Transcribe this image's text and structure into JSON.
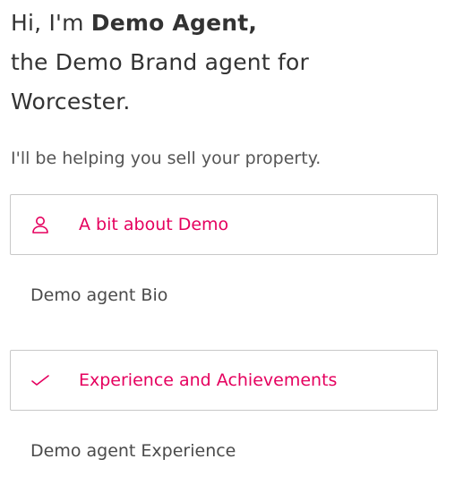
{
  "intro": {
    "greeting": "Hi, I'm ",
    "agent_name": "Demo Agent,",
    "line2": "the Demo Brand agent for",
    "line3": "Worcester."
  },
  "subtitle": "I'll be helping you sell your property.",
  "sections": [
    {
      "header_label": "A bit about Demo",
      "icon": "user-icon",
      "body": "Demo agent Bio"
    },
    {
      "header_label": "Experience and Achievements",
      "icon": "checkmark-icon",
      "body": "Demo agent Experience"
    }
  ],
  "colors": {
    "accent": "#e5005e",
    "text": "#333333",
    "border": "#c8c8c8"
  }
}
